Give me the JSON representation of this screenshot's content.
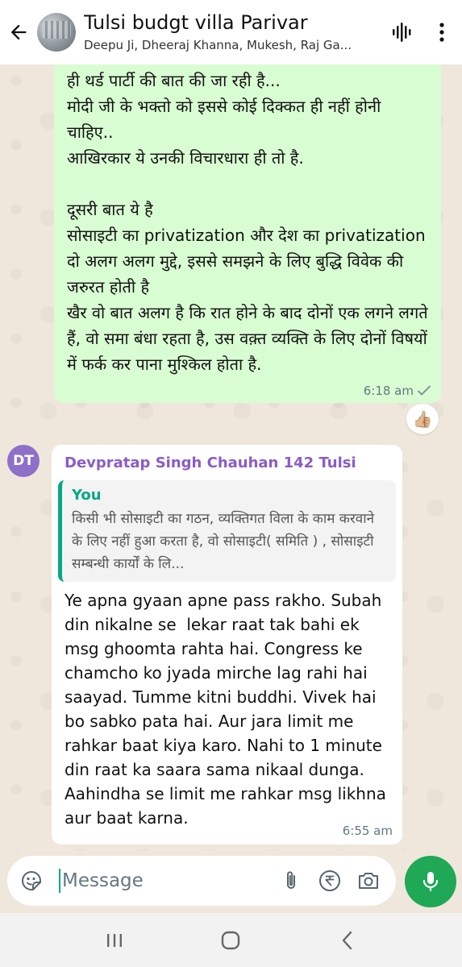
{
  "header": {
    "title": "Tulsi budgt villa Parivar",
    "subtitle": "Deepu Ji, Dheeraj Khanna, Mukesh, Raj Ga..."
  },
  "outgoing_message": {
    "text": "ही थर्ड पार्टी की बात की जा रही है...\nमोदी जी के भक्तो को इससे कोई दिक्कत ही नहीं होनी चाहिए..\nआखिरकार ये उनकी विचारधारा ही तो है.\n\nदूसरी बात ये है\nसोसाइटी का privatization और देश का privatization दो अलग अलग मुद्दे, इससे समझने के लिए बुद्धि विवेक की जरुरत होती है\nखैर वो बात अलग है कि रात होने के बाद दोनों एक लगने लगते हैं, वो समा बंधा रहता है, उस वक़्त व्यक्ति के लिए दोनों विषयों में फर्क कर पाना मुश्किल होता है.",
    "time": "6:18 am",
    "status_icon": "check-icon",
    "reaction": "👍🏼"
  },
  "incoming_message": {
    "avatar_initials": "DT",
    "sender": "Devpratap Singh Chauhan 142 Tulsi",
    "quote_author": "You",
    "quote_text": "किसी भी सोसाइटी का गठन, व्यक्तिगत विला के काम करवाने के लिए नहीं हुआ करता है, वो सोसाइटी( समिति ) , सोसाइटी सम्बन्धी कार्यों के लि...",
    "text": "Ye apna gyaan apne pass rakho. Subah din nikalne se  lekar raat tak bahi ek msg ghoomta rahta hai. Congress ke chamcho ko jyada mirche lag rahi hai saayad. Tumme kitni buddhi. Vivek hai bo sabko pata hai. Aur jara limit me rahkar baat kiya karo. Nahi to 1 minute din raat ka saara sama nikaal dunga. Aahindha se limit me rahkar msg likhna aur baat karna.",
    "time": "6:55 am"
  },
  "input": {
    "placeholder": "Message",
    "value": ""
  },
  "colors": {
    "accent": "#1fa855",
    "outgoing_bubble": "#d9fdd3",
    "sender_name": "#8a5cc7",
    "quote_accent": "#06a884"
  }
}
